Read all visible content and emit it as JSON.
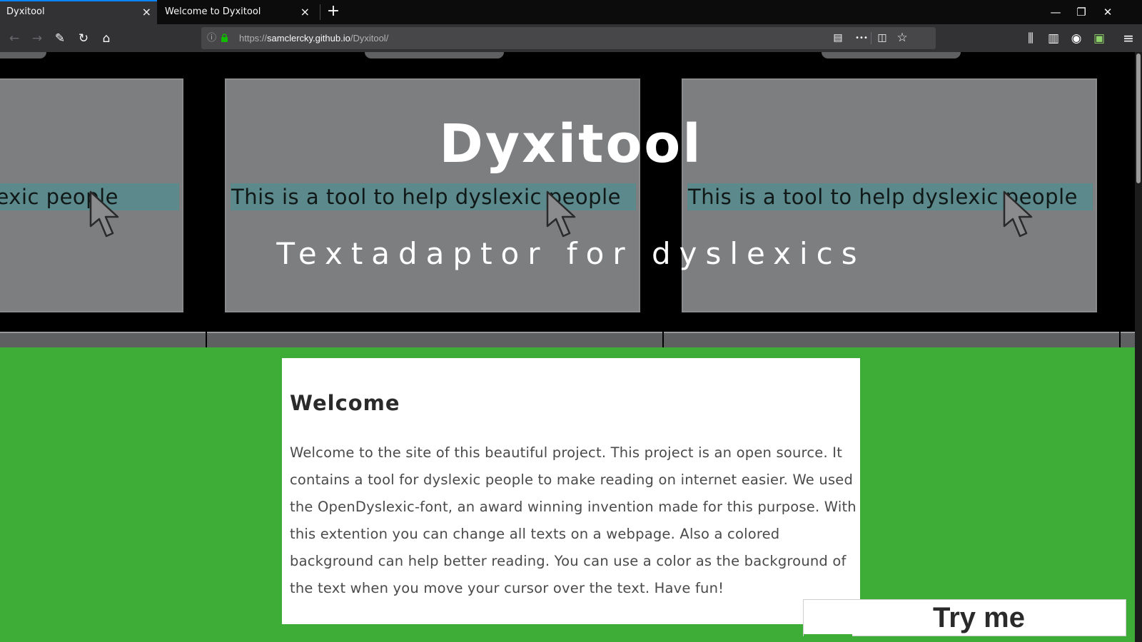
{
  "browser": {
    "tabs": [
      {
        "title": "Dyxitool",
        "active": true
      },
      {
        "title": "Welcome to Dyxitool",
        "active": false
      }
    ],
    "url": {
      "scheme": "https://",
      "host": "samclercky.github.io",
      "path": "/Dyxitool/"
    },
    "icons": {
      "close_tab": "×",
      "new_tab": "+",
      "minimize": "—",
      "restore": "❐",
      "close_window": "✕",
      "back": "←",
      "forward": "→",
      "tools": "✎",
      "reload": "↻",
      "home": "⌂",
      "info": "ⓘ",
      "reader": "▤",
      "more": "•••",
      "pocket": "◫",
      "bookmark": "☆",
      "library": "⫼",
      "sidebar": "▥",
      "account": "◉",
      "extension": "▣",
      "menu": "≡"
    },
    "accent_color": "#0a84ff"
  },
  "hero": {
    "title": "Dyxitool",
    "subtitle": "Textadaptor for dyslexics",
    "slides": [
      {
        "text": "This is a tool to help dyslexic people"
      },
      {
        "text": "This is a tool to help dyslexic people"
      },
      {
        "text": "This is a tool to help dyslexic people"
      }
    ]
  },
  "welcome": {
    "heading": "Welcome",
    "body": "Welcome to the site of this beautiful project. This project is an open source. It contains a tool for dyslexic people to make reading on internet easier. We used the OpenDyslexic-font, an award winning invention made for this purpose. With this extention you can change all texts on a webpage. Also a colored background can help better reading. You can use a color as the background of the text when you move your cursor over the text. Have fun!"
  },
  "cta": {
    "label": "Try me"
  },
  "colors": {
    "page_green": "#3dad38",
    "highlight": "#5c898b"
  }
}
